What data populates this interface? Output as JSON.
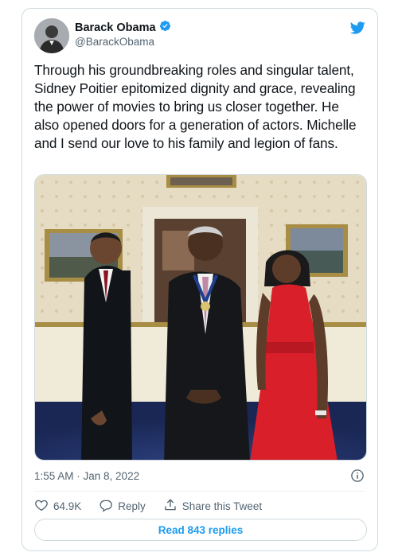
{
  "author": {
    "display_name": "Barack Obama",
    "handle": "@BarackObama",
    "verified": true
  },
  "tweet": {
    "text": "Through his groundbreaking roles and singular talent, Sidney Poitier epitomized dignity and grace, revealing the power of movies to bring us closer together. He also opened doors for a generation of actors. Michelle and I send our love to his family and legion of fans.",
    "timestamp": "1:55 AM · Jan 8, 2022"
  },
  "actions": {
    "like_count": "64.9K",
    "reply_label": "Reply",
    "share_label": "Share this Tweet"
  },
  "read_replies_label": "Read 843 replies",
  "icons": {
    "logo": "twitter-bird-icon",
    "verified": "verified-badge-icon",
    "info": "info-icon",
    "like": "heart-icon",
    "reply": "reply-icon",
    "share": "share-icon"
  },
  "colors": {
    "accent": "#1d9bf0",
    "text": "#0f1419",
    "secondary": "#536471",
    "border": "#cfd9de"
  }
}
